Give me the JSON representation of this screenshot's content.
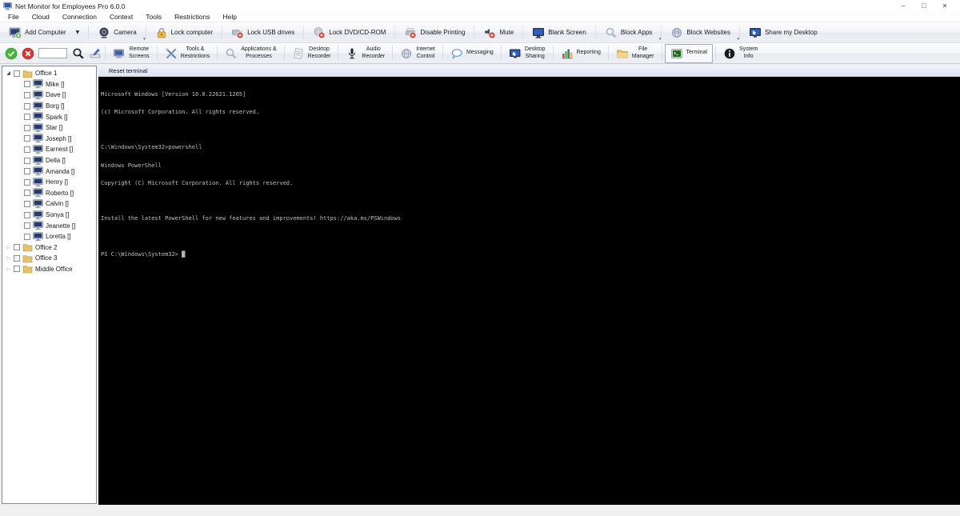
{
  "window": {
    "title": "Net Monitor for Employees Pro 6.0.0",
    "controls": {
      "minimize": "–",
      "maximize": "□",
      "close": "✕"
    }
  },
  "menu": {
    "items": [
      "File",
      "Cloud",
      "Connection",
      "Context",
      "Tools",
      "Restrictions",
      "Help"
    ]
  },
  "glyphs": {
    "dropdown_arrow": "▼",
    "small_caret": "▾",
    "expander_expanded": "◢",
    "expander_collapsed": "▷",
    "cursor": "█"
  },
  "action_toolbar": {
    "items": [
      {
        "label": "Add Computer",
        "icon": "monitor-add-icon",
        "has_dropdown": true
      },
      {
        "label": "Camera",
        "icon": "webcam-icon",
        "has_dropdown": true
      },
      {
        "label": "Lock computer",
        "icon": "padlock-icon"
      },
      {
        "label": "Lock USB drives",
        "icon": "usb-blocked-icon"
      },
      {
        "label": "Lock DVD/CD-ROM",
        "icon": "disc-blocked-icon"
      },
      {
        "label": "Disable Printing",
        "icon": "printer-blocked-icon"
      },
      {
        "label": "Mute",
        "icon": "speaker-blocked-icon"
      },
      {
        "label": "Blank Screen",
        "icon": "blue-monitor-icon"
      },
      {
        "label": "Block Apps",
        "icon": "magnifier-icon",
        "has_dropdown": true
      },
      {
        "label": "Block Websites",
        "icon": "globe-icon",
        "has_dropdown": true
      },
      {
        "label": "Share my Desktop",
        "icon": "monitor-share-icon"
      }
    ]
  },
  "feature_toolbar": {
    "connect": {
      "icon": "green-check-icon"
    },
    "disconnect": {
      "icon": "red-x-icon"
    },
    "search": {
      "value": "",
      "icon": "magnifier-icon"
    },
    "edit": {
      "icon": "notepad-pencil-icon"
    },
    "buttons": [
      {
        "line1": "Remote",
        "line2": "Screens",
        "icon": "screens-icon"
      },
      {
        "line1": "Tools &",
        "line2": "Restrictions",
        "icon": "crossed-tools-icon"
      },
      {
        "line1": "Applications &",
        "line2": "Processes",
        "icon": "magnifier-icon"
      },
      {
        "line1": "Desktop",
        "line2": "Recorder",
        "icon": "recorder-document-icon"
      },
      {
        "line1": "Audio",
        "line2": "Recorder",
        "icon": "microphone-icon"
      },
      {
        "line1": "Internet",
        "line2": "Control",
        "icon": "globe-icon"
      },
      {
        "line1": "Messaging",
        "line2": "",
        "icon": "speech-bubble-icon"
      },
      {
        "line1": "Desktop",
        "line2": "Sharing",
        "icon": "monitor-share-icon"
      },
      {
        "line1": "Reporting",
        "line2": "",
        "icon": "bar-chart-icon"
      },
      {
        "line1": "File",
        "line2": "Manager",
        "icon": "folder-icon"
      },
      {
        "line1": "Terminal",
        "line2": "",
        "icon": "terminal-icon",
        "selected": true
      },
      {
        "line1": "System",
        "line2": "Info",
        "icon": "info-icon"
      }
    ]
  },
  "sidebar": {
    "groups": [
      {
        "label": "Office 1",
        "expanded": true
      },
      {
        "label": "Office 2",
        "expanded": false
      },
      {
        "label": "Office 3",
        "expanded": false
      },
      {
        "label": "Middle Office",
        "expanded": false
      }
    ],
    "computers": [
      "Mike []",
      "Dave []",
      "Borg []",
      "Spark []",
      "Star []",
      "Joseph []",
      "Earnest []",
      "Della []",
      "Amanda []",
      "Henry []",
      "Roberto []",
      "Calvin []",
      "Sonya []",
      "Jeanette []",
      "Loretta []"
    ]
  },
  "main": {
    "reset_button_label": "Reset terminal",
    "terminal": {
      "lines": [
        "Microsoft Windows [Version 10.0.22621.1265]",
        "(c) Microsoft Corporation. All rights reserved.",
        "",
        "C:\\Windows\\System32>powershell",
        "Windows PowerShell",
        "Copyright (C) Microsoft Corporation. All rights reserved.",
        "",
        "Install the latest PowerShell for new features and improvements! https://aka.ms/PSWindows",
        "",
        "PS C:\\Windows\\System32> "
      ]
    }
  },
  "colors": {
    "terminal_bg": "#000000",
    "terminal_fg": "#bfbfbf",
    "connect_green": "#46b53a",
    "disconnect_red": "#d23b30",
    "folder_yellow": "#e9c166",
    "reset_bar": "#dde2f2",
    "selected_button_bg": "#ffffff"
  }
}
